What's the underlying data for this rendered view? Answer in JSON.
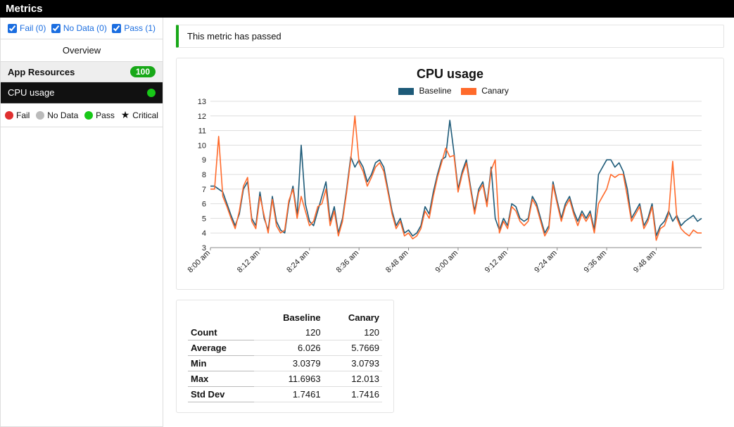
{
  "title": "Metrics",
  "filters": [
    {
      "label": "Fail (0)",
      "checked": true
    },
    {
      "label": "No Data (0)",
      "checked": true
    },
    {
      "label": "Pass (1)",
      "checked": true
    }
  ],
  "overview_label": "Overview",
  "group": {
    "name": "App Resources",
    "score": "100"
  },
  "metric": {
    "name": "CPU usage",
    "status_color": "#18c818"
  },
  "legend": [
    {
      "label": "Fail",
      "color": "#e03030"
    },
    {
      "label": "No Data",
      "color": "#bbbbbb"
    },
    {
      "label": "Pass",
      "color": "#18c818"
    },
    {
      "label": "Critical",
      "icon": "star"
    }
  ],
  "status_banner": "This metric has passed",
  "chart_data": {
    "type": "line",
    "title": "CPU usage",
    "xlabel": "",
    "ylabel": "",
    "ylim": [
      3,
      13
    ],
    "yticks": [
      3,
      4,
      5,
      6,
      7,
      8,
      9,
      10,
      11,
      12,
      13
    ],
    "x": [
      0,
      1,
      2,
      3,
      4,
      5,
      6,
      7,
      8,
      9,
      10,
      11,
      12,
      13,
      14,
      15,
      16,
      17,
      18,
      19,
      20,
      21,
      22,
      23,
      24,
      25,
      26,
      27,
      28,
      29,
      30,
      31,
      32,
      33,
      34,
      35,
      36,
      37,
      38,
      39,
      40,
      41,
      42,
      43,
      44,
      45,
      46,
      47,
      48,
      49,
      50,
      51,
      52,
      53,
      54,
      55,
      56,
      57,
      58,
      59,
      60,
      61,
      62,
      63,
      64,
      65,
      66,
      67,
      68,
      69,
      70,
      71,
      72,
      73,
      74,
      75,
      76,
      77,
      78,
      79,
      80,
      81,
      82,
      83,
      84,
      85,
      86,
      87,
      88,
      89,
      90,
      91,
      92,
      93,
      94,
      95,
      96,
      97,
      98,
      99,
      100,
      101,
      102,
      103,
      104,
      105,
      106,
      107,
      108,
      109,
      110,
      111,
      112,
      113,
      114,
      115,
      116,
      117,
      118,
      119
    ],
    "x_tick_positions": [
      0,
      12,
      24,
      36,
      48,
      60,
      72,
      84,
      96,
      108
    ],
    "x_tick_labels": [
      "8:00 am",
      "8:12 am",
      "8:24 am",
      "8:36 am",
      "8:48 am",
      "9:00 am",
      "9:12 am",
      "9:24 am",
      "9:36 am",
      "9:48 am"
    ],
    "series": [
      {
        "name": "Baseline",
        "color": "#1d5a78",
        "values": [
          7.2,
          7.2,
          7.0,
          6.8,
          6.0,
          5.2,
          4.5,
          5.3,
          7.0,
          7.5,
          5.0,
          4.5,
          6.8,
          5.0,
          4.2,
          6.5,
          4.8,
          4.2,
          4.0,
          6.0,
          7.2,
          5.2,
          10.0,
          6.0,
          4.8,
          4.5,
          5.5,
          6.5,
          7.5,
          4.8,
          5.8,
          4.0,
          5.0,
          7.0,
          9.2,
          8.5,
          9.0,
          8.5,
          7.5,
          8.0,
          8.8,
          9.0,
          8.5,
          7.0,
          5.5,
          4.5,
          5.0,
          4.0,
          4.2,
          3.8,
          4.0,
          4.5,
          5.8,
          5.3,
          6.8,
          8.0,
          9.0,
          9.2,
          11.7,
          9.5,
          7.0,
          8.2,
          9.0,
          7.2,
          5.5,
          7.0,
          7.5,
          6.0,
          8.5,
          5.0,
          4.2,
          5.0,
          4.5,
          6.0,
          5.8,
          5.0,
          4.8,
          5.0,
          6.5,
          6.0,
          5.0,
          4.0,
          4.5,
          7.5,
          6.2,
          5.0,
          6.0,
          6.5,
          5.5,
          4.8,
          5.5,
          5.0,
          5.5,
          4.2,
          8.0,
          8.5,
          9.0,
          9.0,
          8.5,
          8.8,
          8.2,
          7.0,
          5.0,
          5.5,
          6.0,
          4.5,
          5.0,
          6.0,
          3.8,
          4.5,
          4.8,
          5.5,
          4.8,
          5.2,
          4.5,
          4.8,
          5.0,
          5.2,
          4.8,
          5.0
        ]
      },
      {
        "name": "Canary",
        "color": "#ff6a2b",
        "values": [
          7.0,
          7.0,
          10.6,
          6.5,
          5.8,
          5.0,
          4.3,
          5.5,
          7.2,
          7.8,
          4.8,
          4.3,
          6.5,
          5.2,
          4.0,
          6.3,
          4.5,
          4.0,
          4.2,
          6.2,
          7.0,
          5.0,
          6.5,
          5.5,
          4.5,
          4.8,
          5.8,
          6.0,
          7.0,
          4.5,
          5.5,
          3.8,
          4.8,
          6.8,
          9.0,
          12.0,
          8.8,
          8.2,
          7.2,
          7.8,
          8.5,
          8.8,
          8.2,
          6.8,
          5.3,
          4.3,
          4.8,
          3.8,
          4.0,
          3.6,
          3.8,
          4.3,
          5.5,
          5.0,
          6.5,
          7.8,
          8.8,
          9.8,
          9.2,
          9.3,
          6.8,
          8.0,
          8.8,
          7.0,
          5.3,
          6.8,
          7.3,
          5.8,
          8.3,
          9.0,
          4.0,
          4.8,
          4.3,
          5.8,
          5.5,
          4.8,
          4.5,
          4.8,
          6.3,
          5.8,
          4.8,
          3.8,
          4.3,
          7.3,
          6.0,
          4.8,
          5.8,
          6.3,
          5.3,
          4.5,
          5.3,
          4.8,
          5.3,
          4.0,
          6.0,
          6.5,
          7.0,
          8.0,
          7.8,
          8.0,
          8.0,
          6.5,
          4.8,
          5.3,
          5.8,
          4.3,
          4.8,
          5.8,
          3.5,
          4.3,
          4.5,
          5.3,
          8.9,
          5.0,
          4.3,
          4.0,
          3.8,
          4.2,
          4.0,
          4.0
        ]
      }
    ]
  },
  "stats": {
    "columns": [
      "",
      "Baseline",
      "Canary"
    ],
    "rows": [
      {
        "label": "Count",
        "baseline": "120",
        "canary": "120"
      },
      {
        "label": "Average",
        "baseline": "6.026",
        "canary": "5.7669"
      },
      {
        "label": "Min",
        "baseline": "3.0379",
        "canary": "3.0793"
      },
      {
        "label": "Max",
        "baseline": "11.6963",
        "canary": "12.013"
      },
      {
        "label": "Std Dev",
        "baseline": "1.7461",
        "canary": "1.7416"
      }
    ]
  }
}
